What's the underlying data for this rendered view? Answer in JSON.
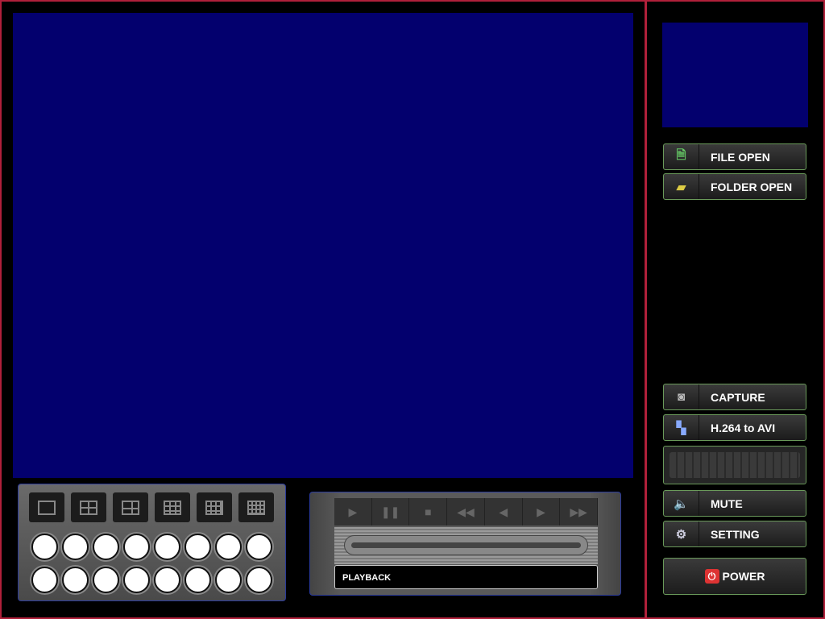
{
  "sidebar": {
    "file_open": "FILE OPEN",
    "folder_open": "FOLDER OPEN",
    "capture": "CAPTURE",
    "convert": "H.264 to AVI",
    "mute": "MUTE",
    "setting": "SETTING",
    "power": "POWER"
  },
  "layouts": [
    "1",
    "4",
    "6",
    "9",
    "13",
    "16"
  ],
  "channels": 16,
  "playback": {
    "label": "PLAYBACK",
    "controls": [
      "play",
      "pause",
      "stop",
      "fast-rewind",
      "step-back",
      "step-forward",
      "fast-forward"
    ]
  },
  "colors": {
    "video_bg": "#03006e",
    "border": "#b0203a",
    "button_border": "#6a9a5a"
  }
}
